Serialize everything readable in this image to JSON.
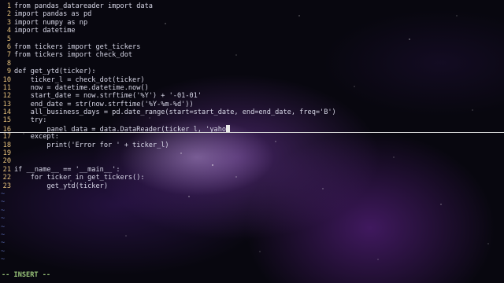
{
  "editor": {
    "code_lines": [
      {
        "no": "1",
        "text": "from pandas_datareader import data"
      },
      {
        "no": "2",
        "text": "import pandas as pd"
      },
      {
        "no": "3",
        "text": "import numpy as np"
      },
      {
        "no": "4",
        "text": "import datetime"
      },
      {
        "no": "5",
        "text": ""
      },
      {
        "no": "6",
        "text": "from tickers import get_tickers"
      },
      {
        "no": "7",
        "text": "from tickers import check_dot"
      },
      {
        "no": "8",
        "text": ""
      },
      {
        "no": "9",
        "text": "def get_ytd(ticker):"
      },
      {
        "no": "10",
        "text": "    ticker_l = check_dot(ticker)"
      },
      {
        "no": "11",
        "text": "    now = datetime.datetime.now()"
      },
      {
        "no": "12",
        "text": "    start_date = now.strftime('%Y') + '-01-01'"
      },
      {
        "no": "13",
        "text": "    end_date = str(now.strftime('%Y-%m-%d'))"
      },
      {
        "no": "14",
        "text": "    all_business_days = pd.date_range(start=start_date, end=end_date, freq='B')"
      },
      {
        "no": "15",
        "text": "    try:"
      },
      {
        "no": "16",
        "text": "        panel_data = data.DataReader(ticker_l, 'yaho"
      },
      {
        "no": "17",
        "text": "    except:"
      },
      {
        "no": "18",
        "text": "        print('Error for ' + ticker_l)"
      },
      {
        "no": "19",
        "text": ""
      },
      {
        "no": "20",
        "text": ""
      },
      {
        "no": "21",
        "text": "if __name__ == '__main__':"
      },
      {
        "no": "22",
        "text": "    for ticker in get_tickers():"
      },
      {
        "no": "23",
        "text": "        get_ytd(ticker)"
      }
    ],
    "empty_line_marker": "~",
    "empty_line_count": 9,
    "cursor_line": "16"
  },
  "statusbar": {
    "mode": "-- INSERT --"
  },
  "colors": {
    "line_number": "#e5c07b",
    "code_text": "#d8d8e8",
    "tilde": "#5566aa",
    "mode_text": "#98c379"
  }
}
